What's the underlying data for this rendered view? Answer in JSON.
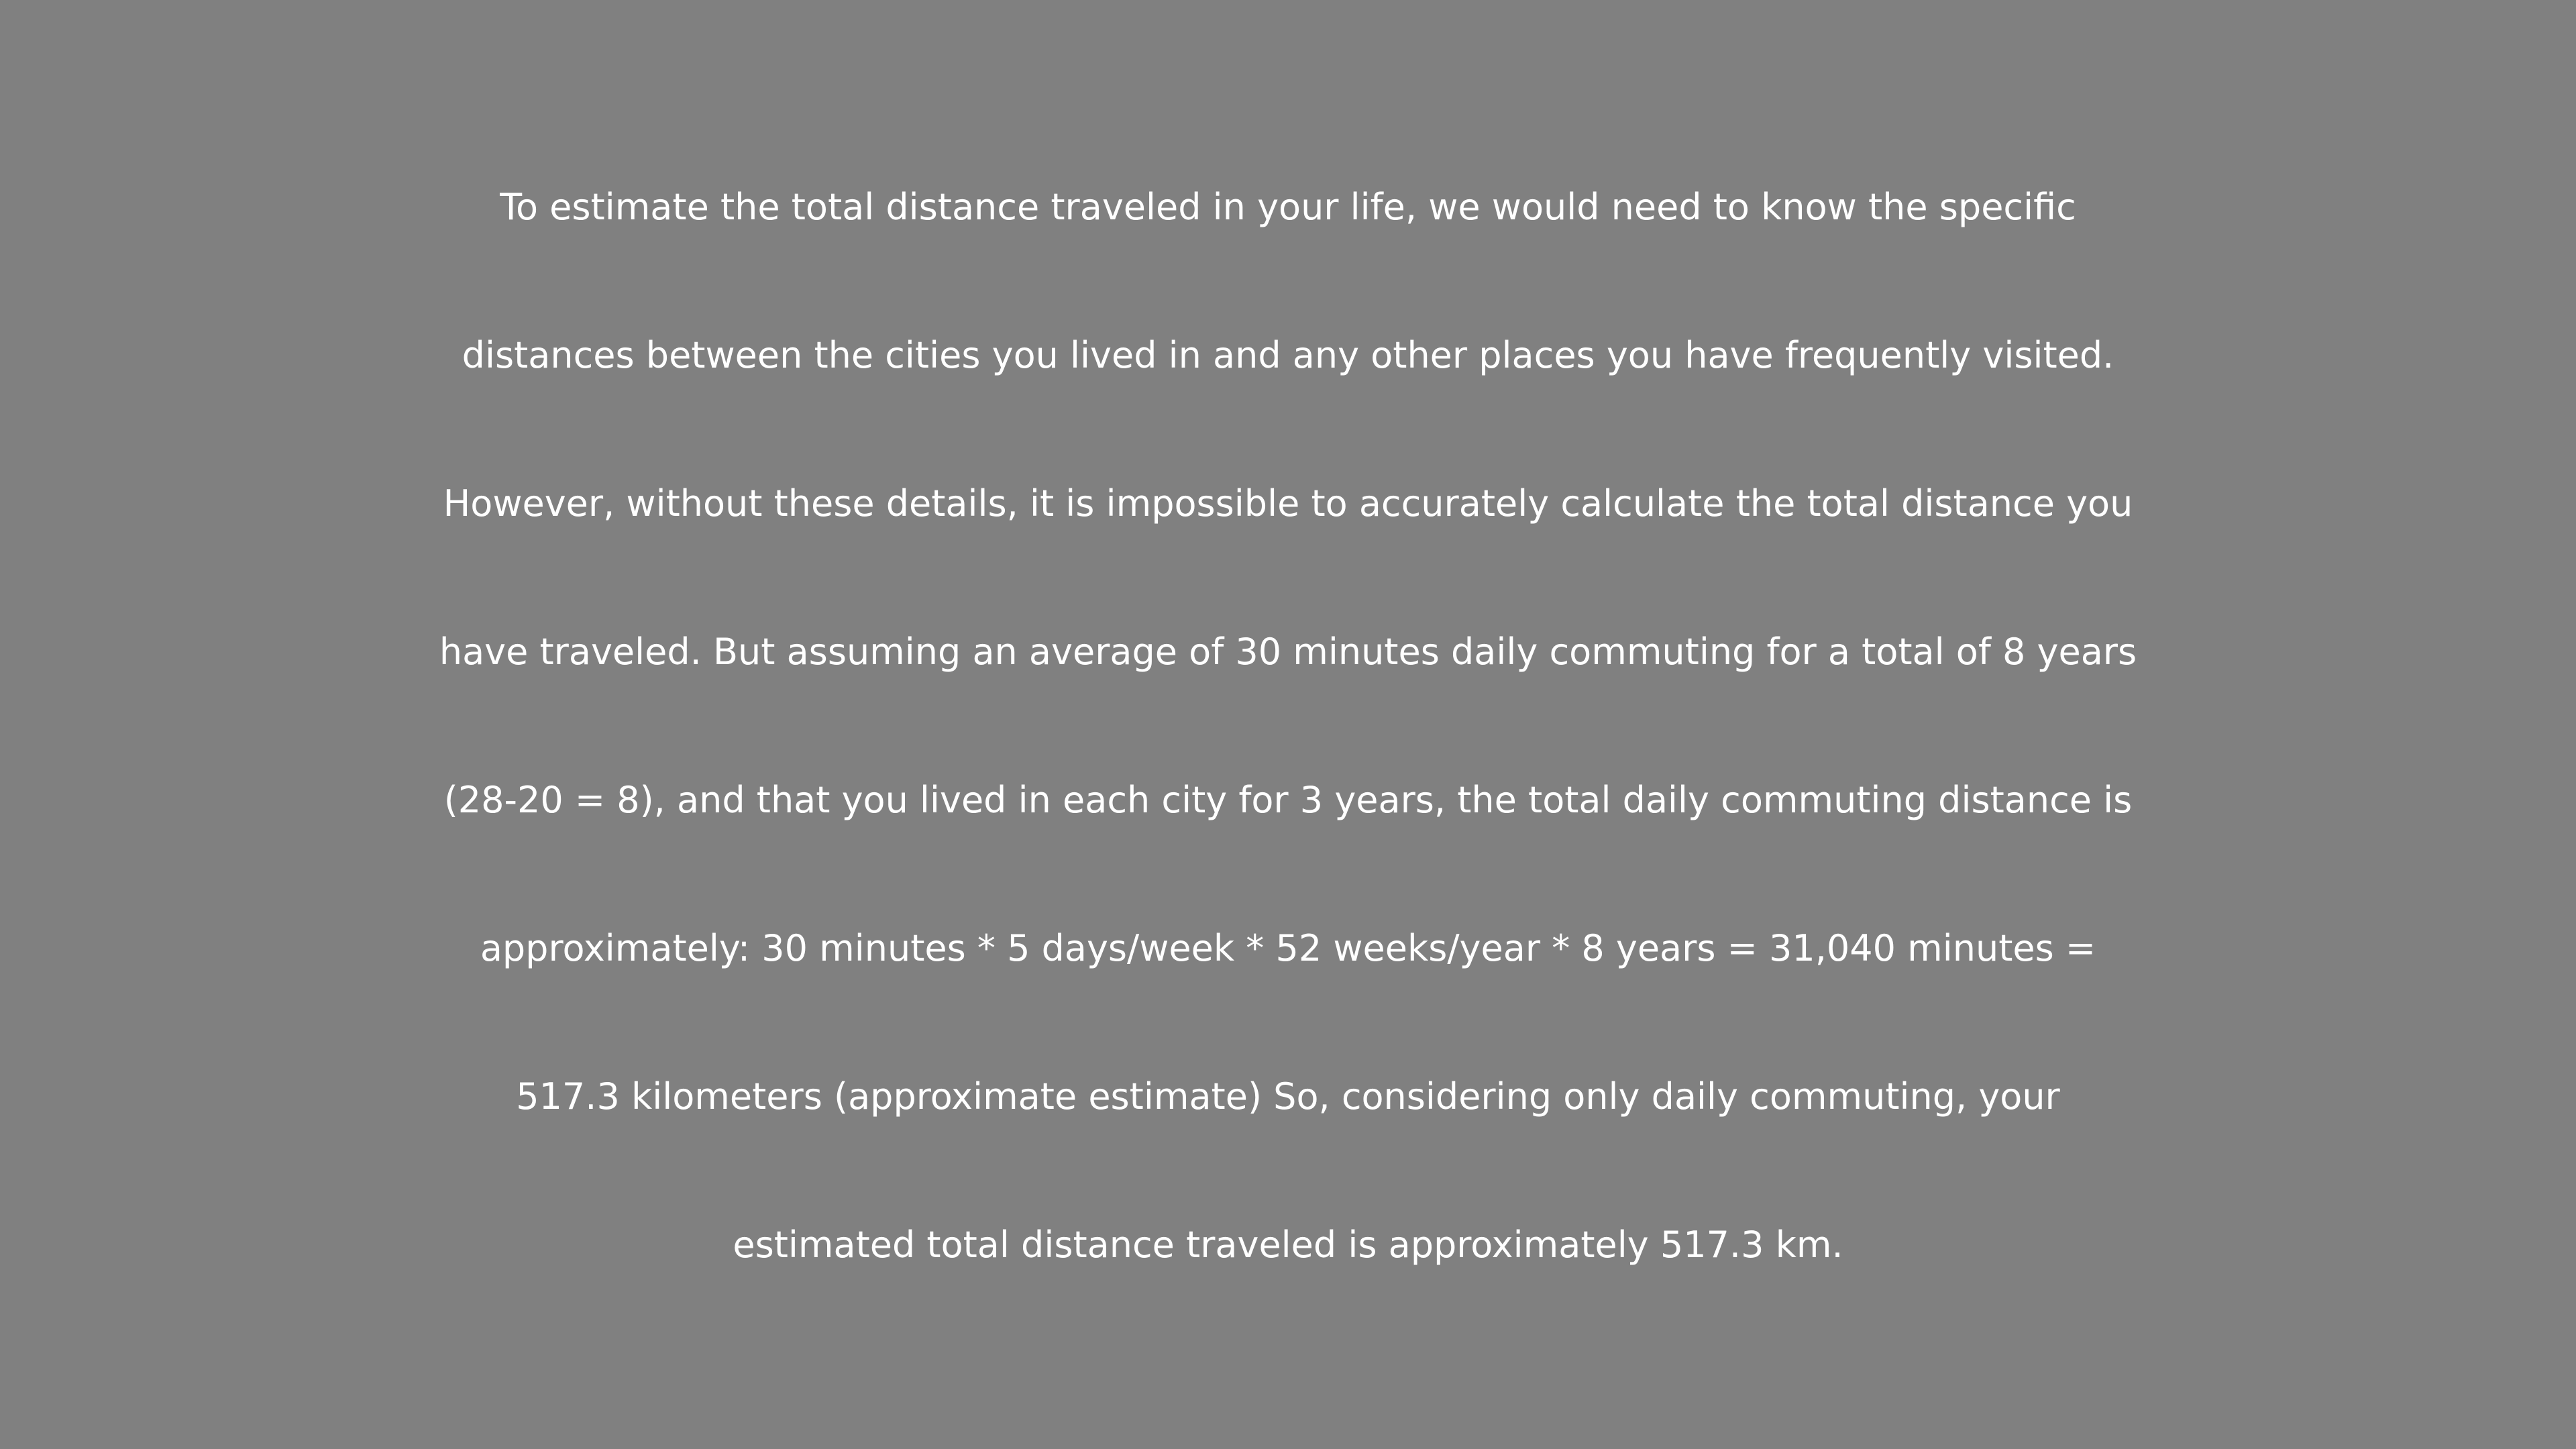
{
  "document": {
    "lines": [
      "To estimate the total distance traveled in your life, we would need to know the specific",
      "distances between the cities you lived in and any other places you have frequently visited.",
      "However, without these details, it is impossible to accurately calculate the total distance you",
      "have traveled. But assuming an average of 30 minutes daily commuting for a total of 8 years",
      "(28-20 = 8), and that you lived in each city for 3 years, the total daily commuting distance is",
      "approximately: 30 minutes * 5 days/week * 52 weeks/year * 8 years = 31,040 minutes =",
      "517.3 kilometers (approximate estimate) So, considering only daily commuting, your",
      "estimated total distance traveled is approximately 517.3 km."
    ]
  },
  "colors": {
    "background": "#808080",
    "text": "#ffffff"
  }
}
